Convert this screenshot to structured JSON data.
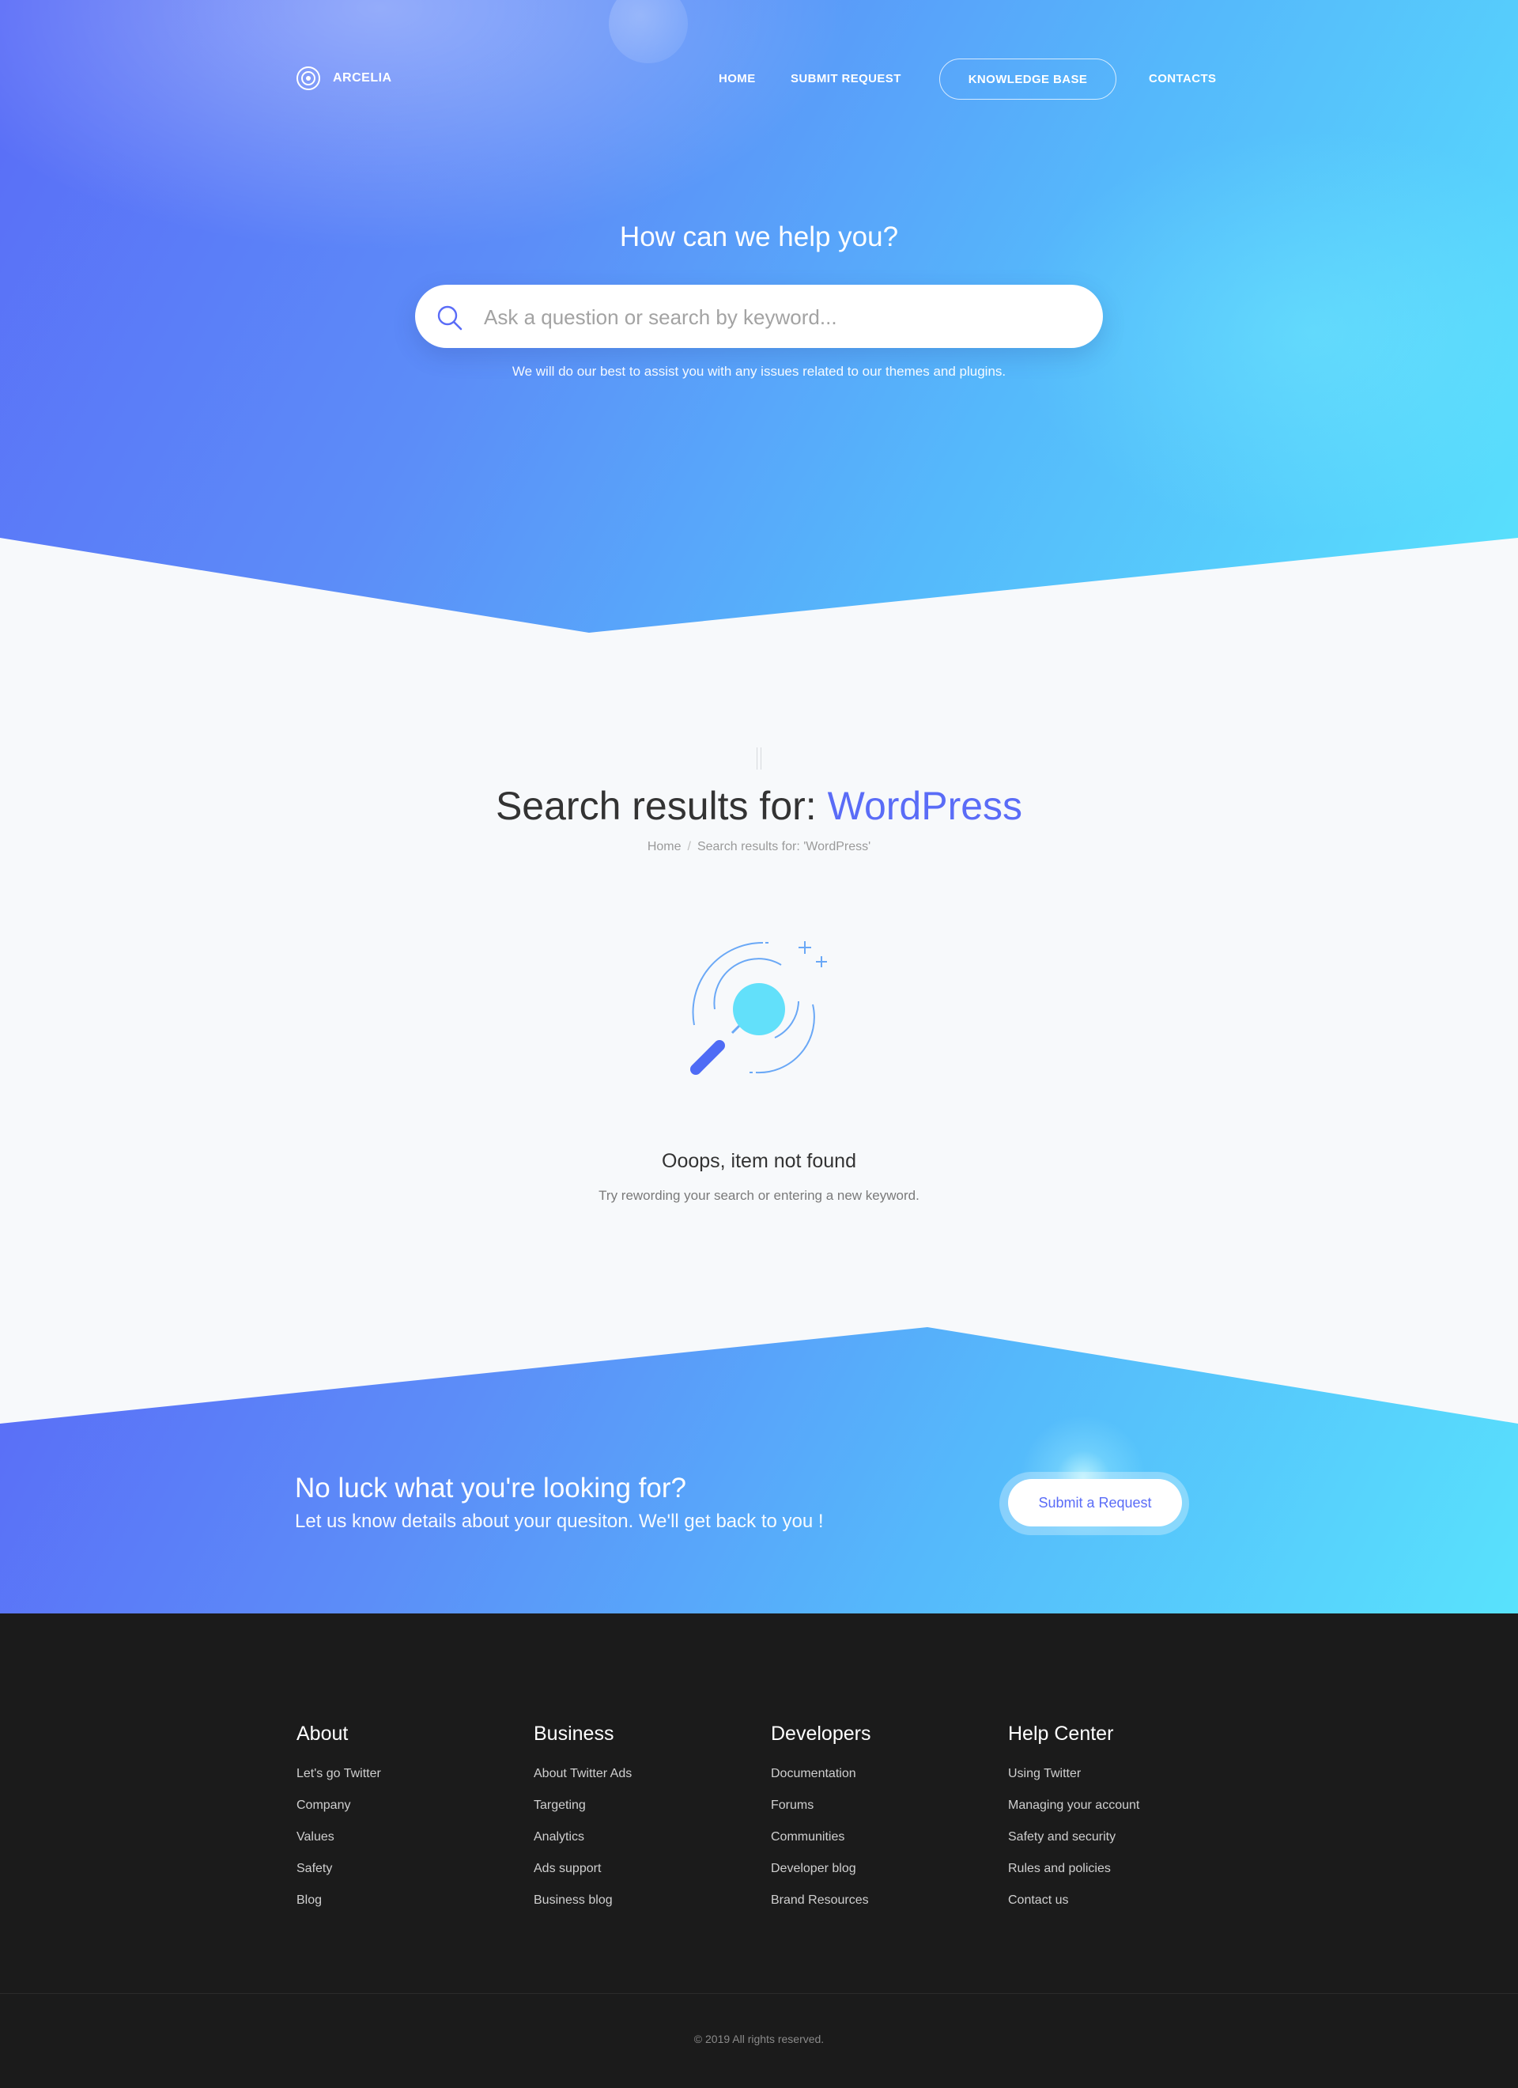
{
  "brand": {
    "name": "ARCELIA"
  },
  "nav": {
    "home": "HOME",
    "submit_request": "SUBMIT REQUEST",
    "knowledge_base": "KNOWLEDGE BASE",
    "contacts": "CONTACTS"
  },
  "hero": {
    "title": "How can we help you?",
    "search_placeholder": "Ask a question or search by keyword...",
    "search_value": "",
    "subtitle": "We will do our best to assist you with any issues related to our themes and plugins."
  },
  "results": {
    "title_prefix": "Search results for:",
    "query": "WordPress",
    "breadcrumb_home": "Home",
    "breadcrumb_current": "Search results for: 'WordPress'",
    "not_found_title": "Ooops, item not found",
    "not_found_sub": "Try rewording your search or entering a new keyword."
  },
  "cta": {
    "title": "No luck what you're looking for?",
    "subtitle": "Let us know details about your quesiton. We'll get back to you !",
    "button": "Submit a Request"
  },
  "footer": {
    "columns": [
      {
        "title": "About",
        "links": [
          "Let's go Twitter",
          "Company",
          "Values",
          "Safety",
          "Blog"
        ]
      },
      {
        "title": "Business",
        "links": [
          "About Twitter Ads",
          "Targeting",
          "Analytics",
          "Ads support",
          "Business blog"
        ]
      },
      {
        "title": "Developers",
        "links": [
          "Documentation",
          "Forums",
          "Communities",
          "Developer blog",
          "Brand Resources"
        ]
      },
      {
        "title": "Help Center",
        "links": [
          "Using Twitter",
          "Managing your account",
          "Safety and security",
          "Rules and policies",
          "Contact us"
        ]
      }
    ],
    "copyright": "© 2019 All rights reserved."
  },
  "colors": {
    "accent": "#5a6cf7",
    "gradient_start": "#5a6cf7",
    "gradient_end": "#58e2fc",
    "footer_bg": "#1b1b1b",
    "page_bg": "#f7f9fb"
  },
  "icons": [
    "logo-icon",
    "search-icon",
    "magnifier-illustration"
  ]
}
